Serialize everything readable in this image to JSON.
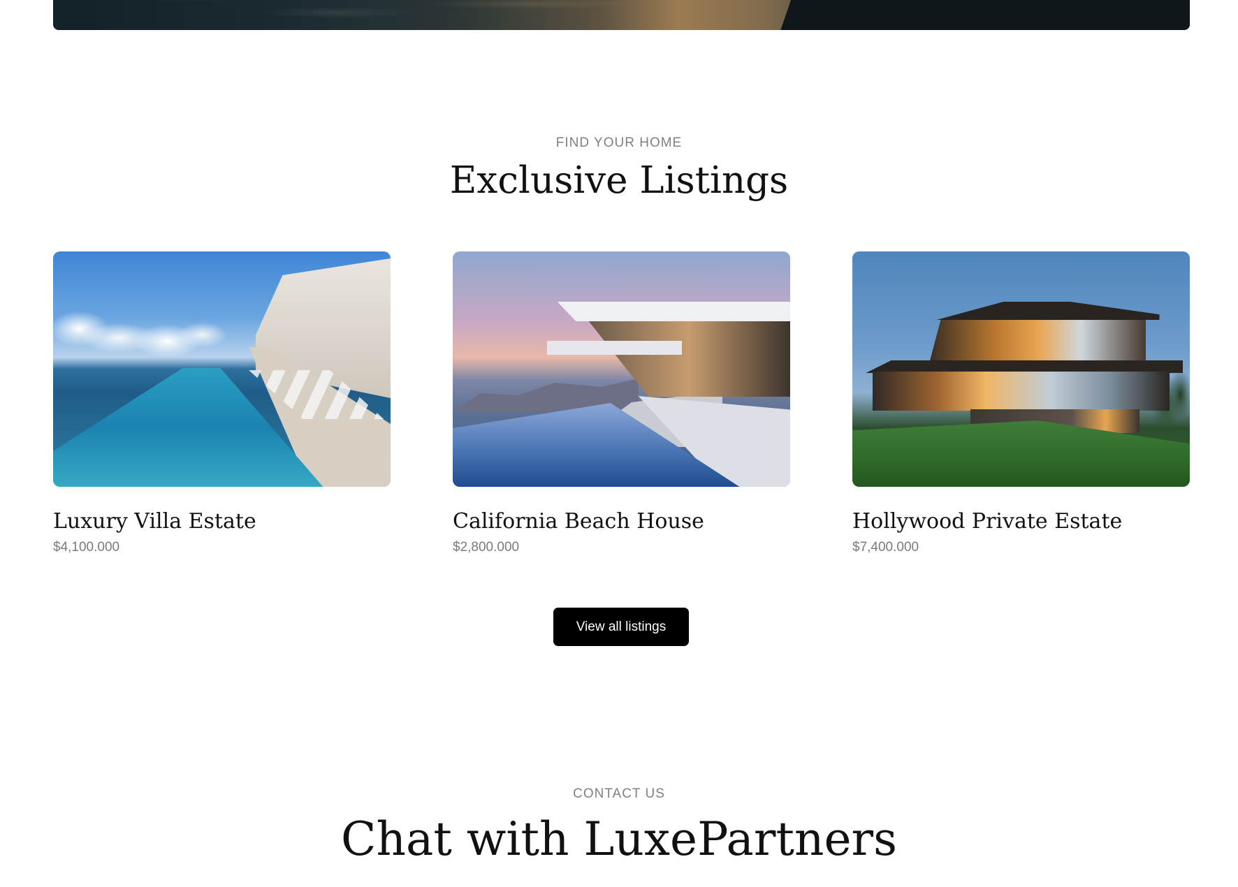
{
  "hero": {
    "image_icon": "lake-sunset-photo"
  },
  "listings_section": {
    "eyebrow": "FIND YOUR HOME",
    "title": "Exclusive Listings",
    "items": [
      {
        "name": "Luxury Villa Estate",
        "price": "$4,100.000",
        "image_icon": "villa-pool-photo"
      },
      {
        "name": "California Beach House",
        "price": "$2,800.000",
        "image_icon": "beach-house-photo"
      },
      {
        "name": "Hollywood Private Estate",
        "price": "$7,400.000",
        "image_icon": "hollywood-estate-photo"
      }
    ],
    "view_all_label": "View all listings"
  },
  "contact_section": {
    "eyebrow": "CONTACT US",
    "title": "Chat with LuxePartners"
  },
  "colors": {
    "background": "#ffffff",
    "text": "#111111",
    "muted": "#7a7a7a",
    "button_bg": "#000000",
    "button_text": "#ffffff"
  }
}
